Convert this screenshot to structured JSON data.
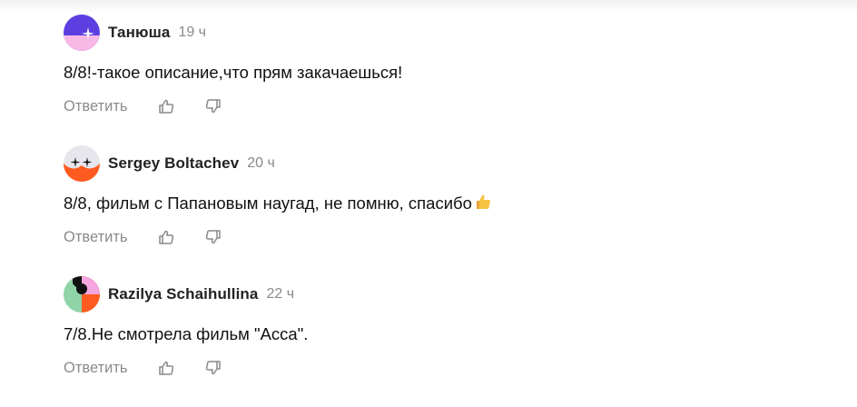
{
  "comments": [
    {
      "author": "Танюша",
      "time": "19 ч",
      "text": "8/8!-такое описание,что прям закачаешься!",
      "reply_label": "Ответить",
      "avatar_colors": [
        "#5b3fe0",
        "#f7b8e6",
        "#ffffff"
      ]
    },
    {
      "author": "Sergey Boltachev",
      "time": "20 ч",
      "text": "8/8, фильм с Папановым наугад, не помню, спасибо",
      "text_emoji": "thumbs-up",
      "reply_label": "Ответить",
      "avatar_colors": [
        "#e6e6ec",
        "#ff5a1f",
        "#1a1a1a"
      ]
    },
    {
      "author": "Razilya Schaihullina",
      "time": "22 ч",
      "text": "7/8.Не смотрела фильм \"Асса\".",
      "reply_label": "Ответить",
      "avatar_colors": [
        "#8fd3a6",
        "#ff5a1f",
        "#111111",
        "#f5a6e0"
      ]
    }
  ],
  "icons": {
    "like": "thumb-up-icon",
    "dislike": "thumb-down-icon"
  },
  "colors": {
    "secondary_text": "#8a8a8a",
    "author_text": "#222222",
    "body_text": "#111111"
  }
}
